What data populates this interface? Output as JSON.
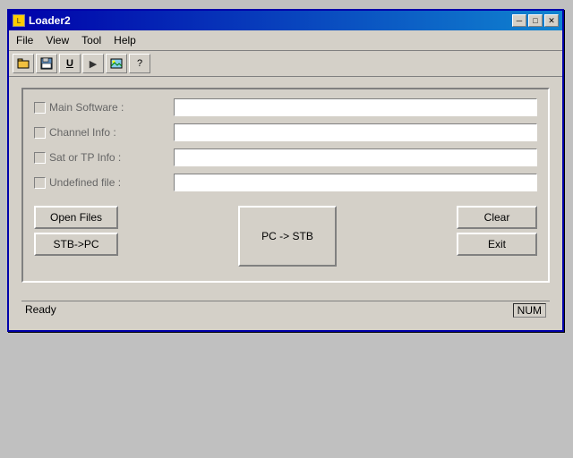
{
  "window": {
    "title": "Loader2",
    "icon": "L"
  },
  "title_buttons": {
    "minimize": "─",
    "maximize": "□",
    "close": "✕"
  },
  "menu": {
    "items": [
      "File",
      "View",
      "Tool",
      "Help"
    ]
  },
  "toolbar": {
    "buttons": [
      {
        "name": "open-icon",
        "symbol": "📂"
      },
      {
        "name": "save-icon",
        "symbol": "💾"
      },
      {
        "name": "underline-icon",
        "symbol": "U"
      },
      {
        "name": "play-icon",
        "symbol": "▶"
      },
      {
        "name": "image-icon",
        "symbol": "🖼"
      },
      {
        "name": "help-icon",
        "symbol": "?"
      }
    ]
  },
  "fields": [
    {
      "id": "main-software",
      "label": "Main Software :",
      "value": "",
      "checked": false
    },
    {
      "id": "channel-info",
      "label": "Channel Info :",
      "value": "",
      "checked": false
    },
    {
      "id": "sat-tp-info",
      "label": "Sat or TP Info :",
      "value": "",
      "checked": false
    },
    {
      "id": "undefined-file",
      "label": "Undefined file :",
      "value": "",
      "checked": false
    }
  ],
  "buttons": {
    "open_files": "Open Files",
    "stb_to_pc": "STB->PC",
    "pc_to_stb": "PC -> STB",
    "clear": "Clear",
    "exit": "Exit"
  },
  "status": {
    "text": "Ready",
    "num": "NUM"
  }
}
